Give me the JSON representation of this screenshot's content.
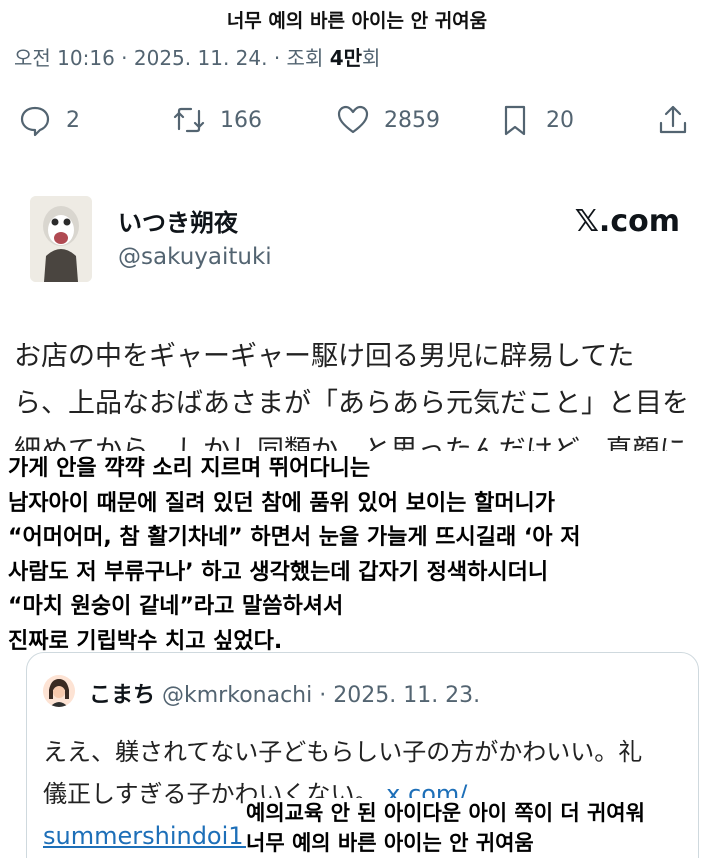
{
  "caption_top": "너무 예의 바른 아이는 안 귀여움",
  "meta": {
    "time": "오전 10:16",
    "sep1": " · ",
    "date": "2025. 11. 24.",
    "sep2": " · ",
    "views_label": "조회 ",
    "views_num": "4만",
    "views_unit": "회"
  },
  "actions": {
    "replies": "2",
    "reposts": "166",
    "likes": "2859",
    "bookmarks": "20"
  },
  "icons": {
    "reply": "reply-icon",
    "repost": "repost-icon",
    "like": "heart-icon",
    "bookmark": "bookmark-icon",
    "share": "share-icon"
  },
  "author": {
    "name": "いつき朔夜",
    "handle": "@sakuyaituki"
  },
  "brand": "𝕏.com",
  "tweet": {
    "line1": "お店の中をギャーギャー駆け回る男児に辟易してた",
    "line2": "ら、上品なおばあさまが「あらあら元気だこと」と目を",
    "line3": "細めてから、しかし同類か...と思ったんだけど、真顔に"
  },
  "translation": [
    "가게 안을 꺅꺅 소리 지르며 뛰어다니는",
    "남자아이 때문에 질려 있던 참에 품위 있어 보이는 할머니가",
    "“어머어머, 참 활기차네” 하면서 눈을 가늘게 뜨시길래 ‘아 저",
    "사람도 저 부류구나’ 하고 생각했는데 갑자기 정색하시더니",
    "“마치 원숭이 같네”라고 말씀하셔서",
    "진짜로 기립박수 치고 싶었다."
  ],
  "quote": {
    "name": "こまち",
    "handle": "@kmrkonachi",
    "sep": " · ",
    "date": "2025. 11. 23.",
    "line1": "ええ、躾されてない子どもらしい子の方がかわいい。礼",
    "line2": "儀正しすぎる子かわいくない。",
    "link1": "x.com/",
    "link2": "summershindoi1..."
  },
  "caption_bottom": {
    "line1": "예의교육 안 된 아이다운 아이 쪽이 더 귀여워",
    "line2": "너무 예의 바른 아이는 안 귀여움"
  }
}
